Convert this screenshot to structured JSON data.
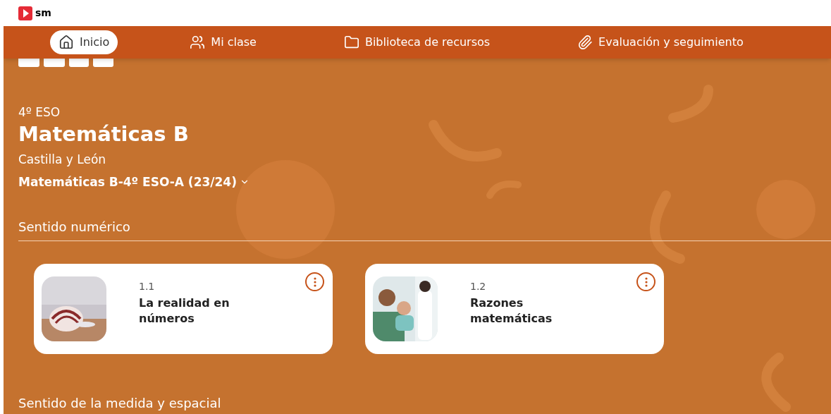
{
  "brand": {
    "name": "sm"
  },
  "nav": [
    {
      "label": "Inicio",
      "selected": true
    },
    {
      "label": "Mi clase",
      "selected": false
    },
    {
      "label": "Biblioteca de recursos",
      "selected": false
    },
    {
      "label": "Evaluación y seguimiento",
      "selected": false
    }
  ],
  "course": {
    "level": "4º ESO",
    "title": "Matemáticas B",
    "region": "Castilla y León",
    "group": "Matemáticas B-4º ESO-A (23/24)"
  },
  "sections": [
    {
      "title": "Sentido numérico",
      "cards": [
        {
          "number": "1.1",
          "title": "La realidad en números"
        },
        {
          "number": "1.2",
          "title": "Razones matemáticas"
        }
      ]
    },
    {
      "title": "Sentido de la medida y espacial"
    }
  ]
}
